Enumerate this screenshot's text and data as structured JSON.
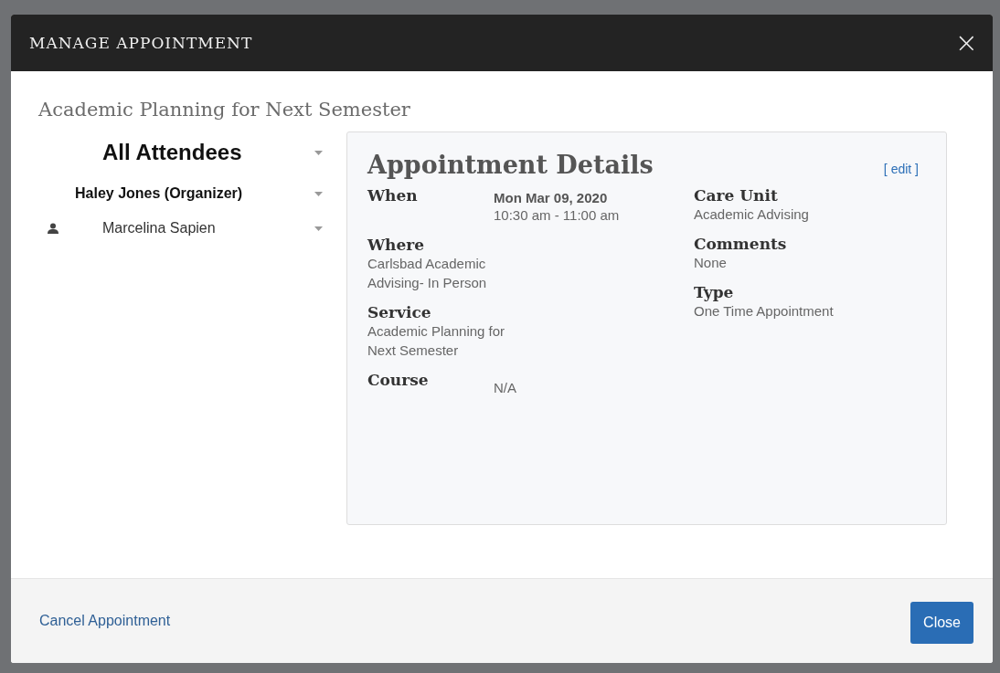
{
  "dialog": {
    "title": "MANAGE APPOINTMENT",
    "close_symbol": "×"
  },
  "heading": "Academic Planning for Next Semester",
  "attendees": [
    {
      "kind": "all",
      "name": "All Attendees"
    },
    {
      "kind": "organizer",
      "name": "Haley Jones (Organizer)"
    },
    {
      "kind": "person",
      "name": "Marcelina Sapien"
    }
  ],
  "details": {
    "title": "Appointment Details",
    "edit_link": "[ edit ]",
    "left": [
      {
        "kind": "schedule",
        "label": "When",
        "date": "Mon Mar 09, 2020",
        "time": "10:30 am - 11:00 am"
      },
      {
        "kind": "stacked",
        "label": "Where",
        "lines": [
          "Carlsbad Academic",
          "Advising- In Person"
        ]
      },
      {
        "kind": "stacked",
        "label": "Service",
        "lines": [
          "Academic Planning for",
          "Next Semester"
        ]
      },
      {
        "kind": "inline",
        "label": "Course",
        "lines": [
          "N/A"
        ]
      }
    ],
    "right": [
      {
        "kind": "stacked",
        "label": "Care Unit",
        "lines": [
          "Academic Advising"
        ]
      },
      {
        "kind": "stacked",
        "label": "Comments",
        "lines": [
          "None"
        ]
      },
      {
        "kind": "stacked",
        "label": "Type",
        "lines": [
          "One Time Appointment"
        ]
      }
    ]
  },
  "footer": {
    "cancel_link": "Cancel Appointment",
    "close_button": "Close"
  }
}
